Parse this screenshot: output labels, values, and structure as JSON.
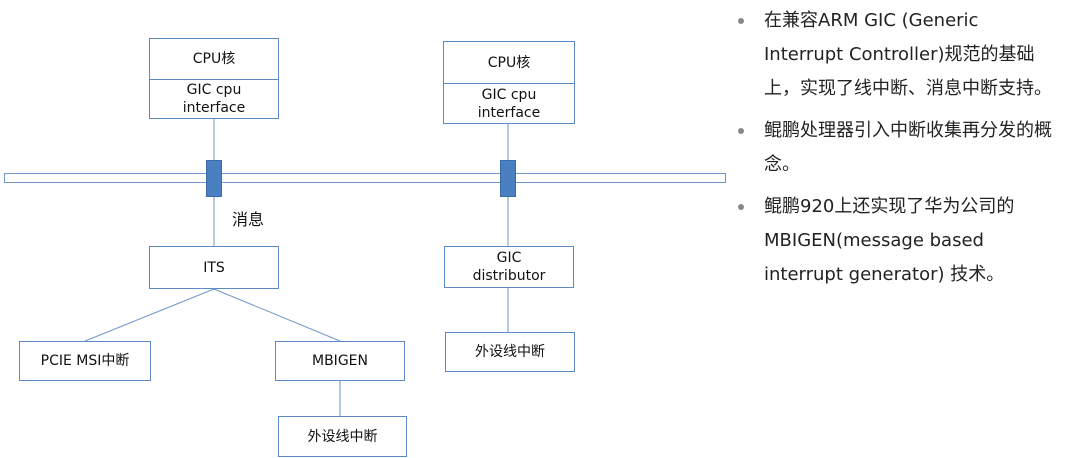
{
  "diagram": {
    "left_core": {
      "cpu_label": "CPU核",
      "interface_label": "GIC cpu\ninterface"
    },
    "right_core": {
      "cpu_label": "CPU核",
      "interface_label": "GIC cpu\ninterface"
    },
    "message_label": "消息",
    "its_label": "ITS",
    "pcie_label": "PCIE MSI中断",
    "mbigen_label": "MBIGEN",
    "mbigen_periph_label": "外设线中断",
    "distributor_label": "GIC\ndistributor",
    "distributor_periph_label": "外设线中断"
  },
  "bullets": [
    "在兼容ARM GIC (Generic Interrupt Controller)规范的基础上，实现了线中断、消息中断支持。",
    "鲲鹏处理器引入中断收集再分发的概念。",
    "鲲鹏920上还实现了华为公司的MBIGEN(message based interrupt generator) 技术。"
  ],
  "colors": {
    "box_border": "#5b8ac6",
    "connector": "#4a7fc1",
    "bullet_dot": "#888888"
  }
}
